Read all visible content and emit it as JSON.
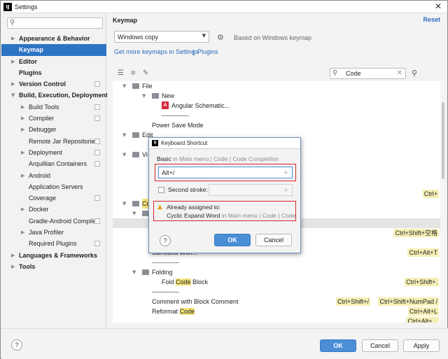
{
  "window": {
    "title": "Settings",
    "app_icon": "IJ"
  },
  "sidebar": {
    "search_placeholder": "",
    "items": [
      {
        "label": "Appearance & Behavior",
        "level": 0,
        "arrow": "▶",
        "bold": true
      },
      {
        "label": "Keymap",
        "level": 0,
        "arrow": "",
        "bold": true,
        "selected": true
      },
      {
        "label": "Editor",
        "level": 0,
        "arrow": "▶",
        "bold": true
      },
      {
        "label": "Plugins",
        "level": 0,
        "arrow": "",
        "bold": true
      },
      {
        "label": "Version Control",
        "level": 0,
        "arrow": "▶",
        "bold": true,
        "cfg": true
      },
      {
        "label": "Build, Execution, Deployment",
        "level": 0,
        "arrow": "▼",
        "bold": true
      },
      {
        "label": "Build Tools",
        "level": 1,
        "arrow": "▶",
        "cfg": true
      },
      {
        "label": "Compiler",
        "level": 1,
        "arrow": "▶",
        "cfg": true
      },
      {
        "label": "Debugger",
        "level": 1,
        "arrow": "▶"
      },
      {
        "label": "Remote Jar Repositories",
        "level": 1,
        "arrow": "",
        "cfg": true
      },
      {
        "label": "Deployment",
        "level": 1,
        "arrow": "▶",
        "cfg": true
      },
      {
        "label": "Arquillian Containers",
        "level": 1,
        "arrow": "",
        "cfg": true
      },
      {
        "label": "Android",
        "level": 1,
        "arrow": "▶"
      },
      {
        "label": "Application Servers",
        "level": 1,
        "arrow": ""
      },
      {
        "label": "Coverage",
        "level": 1,
        "arrow": "",
        "cfg": true
      },
      {
        "label": "Docker",
        "level": 1,
        "arrow": "▶"
      },
      {
        "label": "Gradle-Android Compiler",
        "level": 1,
        "arrow": "",
        "cfg": true
      },
      {
        "label": "Java Profiler",
        "level": 1,
        "arrow": "▶"
      },
      {
        "label": "Required Plugins",
        "level": 1,
        "arrow": "",
        "cfg": true
      },
      {
        "label": "Languages & Frameworks",
        "level": 0,
        "arrow": "▶",
        "bold": true
      },
      {
        "label": "Tools",
        "level": 0,
        "arrow": "▶",
        "bold": true
      }
    ]
  },
  "main": {
    "heading": "Keymap",
    "reset": "Reset",
    "keymap_value": "Windows copy",
    "based_on": "Based on Windows keymap",
    "link1": "Get more keymaps in Settings",
    "link_sep": "|",
    "link2": "Plugins",
    "search_value": "Code"
  },
  "actions": {
    "file": "File",
    "new": "New",
    "angular": "Angular Schematic...",
    "sep1": "-------------",
    "power_save": "Power Save Mode",
    "edit": "Edit",
    "view_partial": "Vi",
    "ctrl_partial": "Ctrl+",
    "code_partial": "Co",
    "ctrl_shift_space": "Ctrl+Shift+空格",
    "surround_partial": "Surround With...",
    "ctrl_alt_t": "Ctrl+Alt+T",
    "sep2": "-------------",
    "folding": "Folding",
    "fold_pre": "Fold ",
    "fold_hl": "Code",
    "fold_post": " Block",
    "fold_short": "Ctrl+Shift+.",
    "sep3": "-------------",
    "comment_block": "Comment with Block Comment",
    "comment_short1": "Ctrl+Shift+/",
    "comment_short2": "Ctrl+Shift+NumPad /",
    "reformat_pre": "Reformat ",
    "reformat_hl": "Code",
    "reformat_short": "Ctrl+Alt+L",
    "last_short": "Ctrl+Alt+..."
  },
  "dialog": {
    "title": "Keyboard Shortcut",
    "basic_label": "Basic",
    "basic_path": " in Main menu | Code | Code Completion",
    "shortcut_value": "Alt+/",
    "second_label": "Second stroke:",
    "warn1": "Already assigned to:",
    "warn2_action": "Cyclic Expand Word",
    "warn2_path": " in Main menu | Code | Code",
    "ok": "OK",
    "cancel": "Cancel",
    "help": "?"
  },
  "bottom": {
    "help": "?",
    "ok": "OK",
    "cancel": "Cancel",
    "apply": "Apply"
  },
  "colors": {
    "selection": "#2d74c4",
    "link": "#2a6bbf",
    "primary_button": "#4a8ed6",
    "highlight": "#f5e27a",
    "error_box": "#d4242c",
    "warning": "#e5a20f"
  }
}
